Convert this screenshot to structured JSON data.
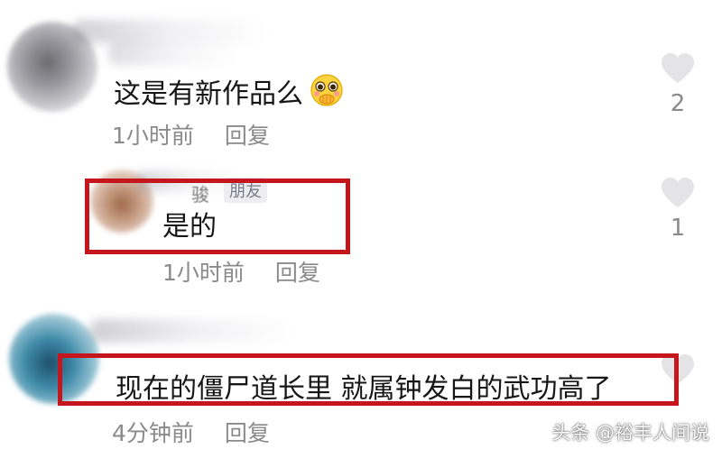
{
  "comments": [
    {
      "text": "这是有新作品么",
      "emoji": "hand-over-mouth-emoji",
      "time": "1小时前",
      "reply_label": "回复",
      "likes": "2"
    },
    {
      "name_fragment": "骏",
      "tag": "朋友",
      "text": "是的",
      "time": "1小时前",
      "reply_label": "回复",
      "likes": "1"
    },
    {
      "text": "现在的僵尸道长里 就属钟发白的武功高了",
      "time": "4分钟前",
      "reply_label": "回复"
    }
  ],
  "highlight_color": "#c4161c",
  "watermark": "头条 @裕丰人间说",
  "icons": {
    "like": "heart-icon"
  }
}
